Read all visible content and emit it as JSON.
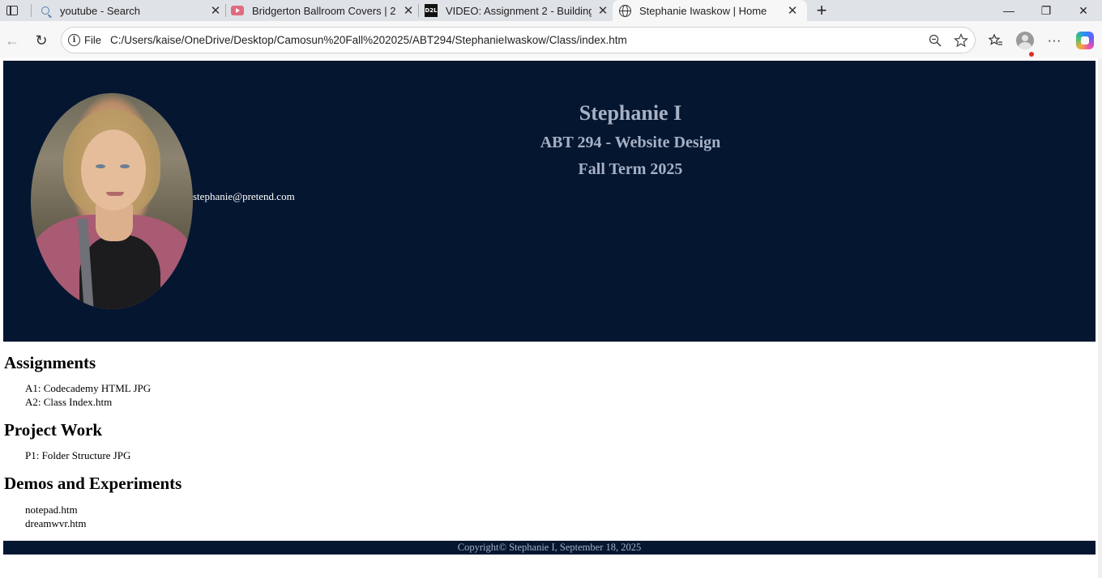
{
  "browser": {
    "tabs": [
      {
        "title": "youtube - Search",
        "icon": "search-icon",
        "active": false
      },
      {
        "title": "Bridgerton Ballroom Covers | 2 Ho",
        "icon": "youtube-icon",
        "active": false
      },
      {
        "title": "VIDEO: Assignment 2 - Building C",
        "icon": "d2l-icon",
        "icon_text": "D2L",
        "active": false
      },
      {
        "title": "Stephanie Iwaskow | Home",
        "icon": "globe-icon",
        "active": true
      }
    ],
    "new_tab_label": "+",
    "window_controls": {
      "minimize": "—",
      "restore": "❐",
      "close": "✕"
    },
    "address_bar": {
      "scheme_label": "File",
      "url": "C:/Users/kaise/OneDrive/Desktop/Camosun%20Fall%202025/ABT294/StephanieIwaskow/Class/index.htm"
    },
    "toolbar_icons": [
      "back-icon",
      "refresh-icon",
      "zoom-icon",
      "favorite-star-icon",
      "favorites-icon",
      "profile-icon",
      "more-icon",
      "copilot-icon"
    ],
    "more_label": "···"
  },
  "page": {
    "header": {
      "name": "Stephanie I",
      "course": "ABT 294 - Website Design",
      "term": "Fall Term 2025",
      "email": "stephanie@pretend.com",
      "background_color": "#051631",
      "title_color": "#a6b1c4"
    },
    "sections": [
      {
        "heading": "Assignments",
        "items": [
          "A1: Codecademy HTML JPG",
          "A2: Class Index.htm"
        ]
      },
      {
        "heading": "Project Work",
        "items": [
          "P1: Folder Structure JPG"
        ]
      },
      {
        "heading": "Demos and Experiments",
        "items": [
          "notepad.htm",
          "dreamwvr.htm"
        ]
      }
    ],
    "footer": {
      "text": "Copyright© Stephanie I, September 18, 2025"
    }
  }
}
